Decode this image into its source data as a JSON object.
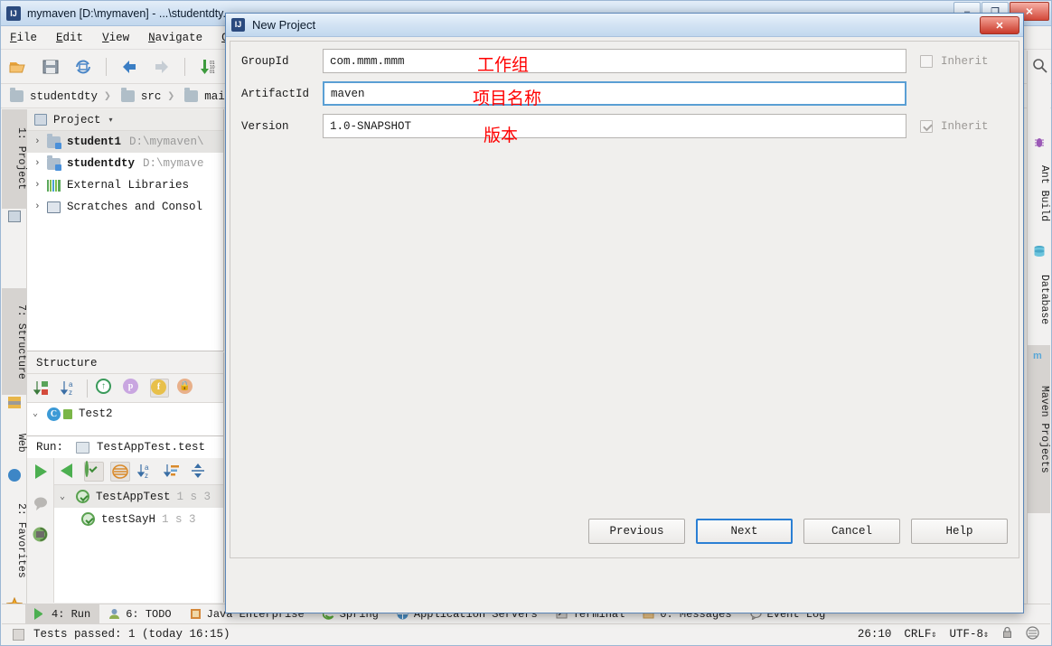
{
  "window": {
    "title": "mymaven [D:\\mymaven] - ...\\studentdty...",
    "app_icon": "intellij-idea-icon",
    "minimize": "–",
    "maximize": "❐",
    "close": "✕"
  },
  "menubar": {
    "items": [
      {
        "label": "File",
        "mnemonic": "F"
      },
      {
        "label": "Edit",
        "mnemonic": "E"
      },
      {
        "label": "View",
        "mnemonic": "V"
      },
      {
        "label": "Navigate",
        "mnemonic": "N"
      },
      {
        "label": "Co",
        "mnemonic": "C"
      }
    ]
  },
  "toolbar": {
    "icons": [
      "open-folder-icon",
      "save-all-icon",
      "sync-icon",
      "back-arrow-icon",
      "forward-arrow-icon",
      "update-project-icon",
      "run-icon"
    ]
  },
  "breadcrumb": {
    "items": [
      "studentdty",
      "src",
      "mai"
    ]
  },
  "left_strip": {
    "tabs": [
      {
        "label": "1: Project",
        "mnemonic": "1",
        "icon": "project-icon",
        "selected": true
      },
      {
        "label": "7: Structure",
        "mnemonic": "7",
        "icon": "structure-icon",
        "selected": true
      },
      {
        "label": "Web",
        "icon": "web-icon",
        "selected": false
      },
      {
        "label": "2: Favorites",
        "mnemonic": "2",
        "icon": "star-icon",
        "selected": false
      }
    ]
  },
  "project_panel": {
    "header": "Project",
    "caret": "▾",
    "tree": [
      {
        "arrow": "›",
        "icon": "module-folder-icon",
        "name": "student1",
        "path": "D:\\mymaven\\",
        "selected": true
      },
      {
        "arrow": "›",
        "icon": "module-folder-icon",
        "name": "studentdty",
        "path": "D:\\mymave",
        "selected": false
      },
      {
        "arrow": "›",
        "icon": "external-libraries-icon",
        "name": "External Libraries",
        "path": "",
        "selected": false
      },
      {
        "arrow": "›",
        "icon": "scratches-icon",
        "name": "Scratches and Consol",
        "path": "",
        "selected": false
      }
    ]
  },
  "structure_panel": {
    "header": "Structure",
    "toolbar_icons": [
      "sort-by-visibility-icon",
      "sort-alphabetically-icon",
      "show-inherited-icon",
      "show-properties-icon",
      "show-fields-icon",
      "show-non-public-icon"
    ],
    "rows": [
      {
        "arrow": "⌄",
        "icon": "class-icon",
        "lock": "public-icon",
        "name": "Test2"
      }
    ],
    "run_label": "Run:",
    "run_config": "TestAppTest.test"
  },
  "run_panel": {
    "side_icons": [
      "run-icon",
      "comment-icon",
      "export-icon",
      "expand-icon"
    ],
    "toolbar_icons": [
      "show-passed-icon",
      "filter-icon",
      "sort-alphabetically-icon",
      "sort-by-duration-icon",
      "expand-all-icon"
    ],
    "rows": [
      {
        "arrow": "⌄",
        "icon": "test-passed-icon",
        "name": "TestAppTest",
        "meta": "1 s 3",
        "highlight": true
      },
      {
        "arrow": "",
        "icon": "test-passed-icon",
        "name": "testSayH",
        "meta": "1 s 3",
        "highlight": false
      }
    ]
  },
  "right_strip": {
    "search_icon": "search-icon",
    "tabs": [
      {
        "label": "Ant Build",
        "icon": "ant-icon",
        "selected": false
      },
      {
        "label": "Database",
        "icon": "database-icon",
        "selected": false
      },
      {
        "label": "Maven Projects",
        "icon": "maven-icon",
        "selected": true
      }
    ]
  },
  "bottom_bar": {
    "tabs": [
      {
        "label": "4: Run",
        "mnemonic": "4",
        "icon": "run-icon",
        "selected": true
      },
      {
        "label": "6: TODO",
        "mnemonic": "6",
        "icon": "todo-icon",
        "selected": false
      },
      {
        "label": "Java Enterprise",
        "icon": "java-ee-icon",
        "selected": false
      },
      {
        "label": "Spring",
        "icon": "spring-icon",
        "selected": false
      },
      {
        "label": "Application Servers",
        "icon": "app-servers-icon",
        "selected": false
      },
      {
        "label": "Terminal",
        "icon": "terminal-icon",
        "selected": false
      },
      {
        "label": "0: Messages",
        "mnemonic": "0",
        "icon": "messages-icon",
        "selected": false
      },
      {
        "label": "Event Log",
        "icon": "event-log-icon",
        "selected": false
      }
    ]
  },
  "status_bar": {
    "message": "Tests passed: 1 (today 16:15)",
    "caret_position": "26:10",
    "line_separator": "CRLF",
    "encoding": "UTF-8",
    "lock_icon": "read-only-lock-icon",
    "inspection_icon": "inspection-icon",
    "stepper": "⇕"
  },
  "dialog": {
    "title": "New Project",
    "icon": "intellij-idea-icon",
    "close_label": "✕",
    "fields": [
      {
        "label": "GroupId",
        "value": "com.mmm.mmm",
        "focused": false,
        "inherit_label": "Inherit",
        "inherit_checked": false,
        "annotation": "工作组"
      },
      {
        "label": "ArtifactId",
        "value": "maven",
        "focused": true,
        "inherit_label": "",
        "inherit_checked": false,
        "annotation": "项目名称"
      },
      {
        "label": "Version",
        "value": "1.0-SNAPSHOT",
        "focused": false,
        "inherit_label": "Inherit",
        "inherit_checked": true,
        "annotation": "版本"
      }
    ],
    "buttons": [
      {
        "label": "Previous",
        "default": false
      },
      {
        "label": "Next",
        "default": true
      },
      {
        "label": "Cancel",
        "default": false
      },
      {
        "label": "Help",
        "default": false
      }
    ]
  },
  "colors": {
    "annotation_red": "#ff0000",
    "focus_blue": "#5a9fd4",
    "default_button_blue": "#2a7fd4",
    "title_blue": "#c2d8ee"
  }
}
